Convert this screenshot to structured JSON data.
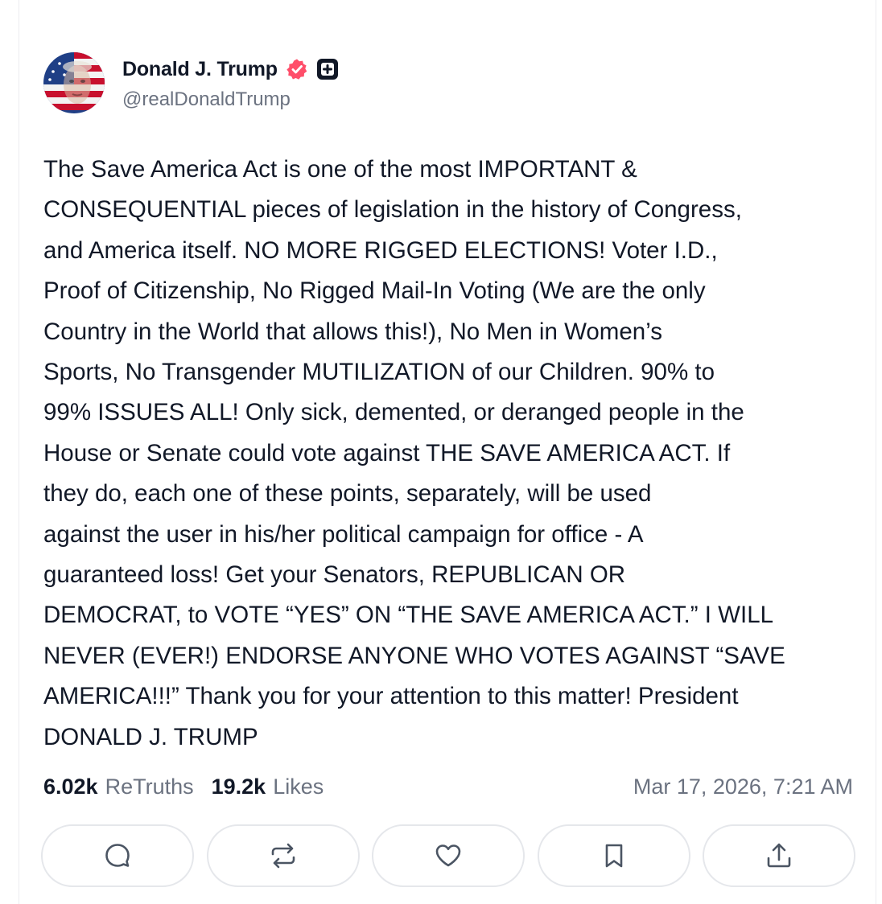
{
  "post": {
    "author": {
      "display_name": "Donald J. Trump",
      "handle": "@realDonaldTrump",
      "verified": true,
      "badge_color": "#ff4e6a"
    },
    "text": "The Save America Act is one of the most IMPORTANT &\nCONSEQUENTIAL pieces of legislation in the history of Congress,\nand America itself. NO MORE RIGGED ELECTIONS! Voter I.D.,\nProof of Citizenship, No Rigged Mail-In Voting (We are the only\nCountry in the World that allows this!), No Men in Women’s\nSports, No Transgender MUTILIZATION of our Children. 90% to\n99% ISSUES ALL! Only sick, demented, or deranged people in the\nHouse or Senate could vote against THE SAVE AMERICA ACT. If\nthey do, each one of these points, separately, will be used\nagainst the user in his/her political campaign for office - A\nguaranteed loss! Get your Senators, REPUBLICAN OR\nDEMOCRAT, to VOTE “YES” ON “THE SAVE AMERICA ACT.” I WILL\nNEVER (EVER!) ENDORSE ANYONE WHO VOTES AGAINST “SAVE\nAMERICA!!!” Thank you for your attention to this matter! President\nDONALD J. TRUMP",
    "stats": {
      "retruths_count": "6.02k",
      "retruths_label": "ReTruths",
      "likes_count": "19.2k",
      "likes_label": "Likes"
    },
    "timestamp": "Mar 17, 2026, 7:21 AM"
  },
  "actions": [
    {
      "name": "reply",
      "icon": "reply-icon"
    },
    {
      "name": "retruth",
      "icon": "retruth-icon"
    },
    {
      "name": "like",
      "icon": "heart-icon"
    },
    {
      "name": "bookmark",
      "icon": "bookmark-icon"
    },
    {
      "name": "share",
      "icon": "share-icon"
    }
  ],
  "colors": {
    "text_primary": "#111827",
    "text_secondary": "#6b7280",
    "border": "#e5e7eb",
    "icon": "#4b5563"
  }
}
